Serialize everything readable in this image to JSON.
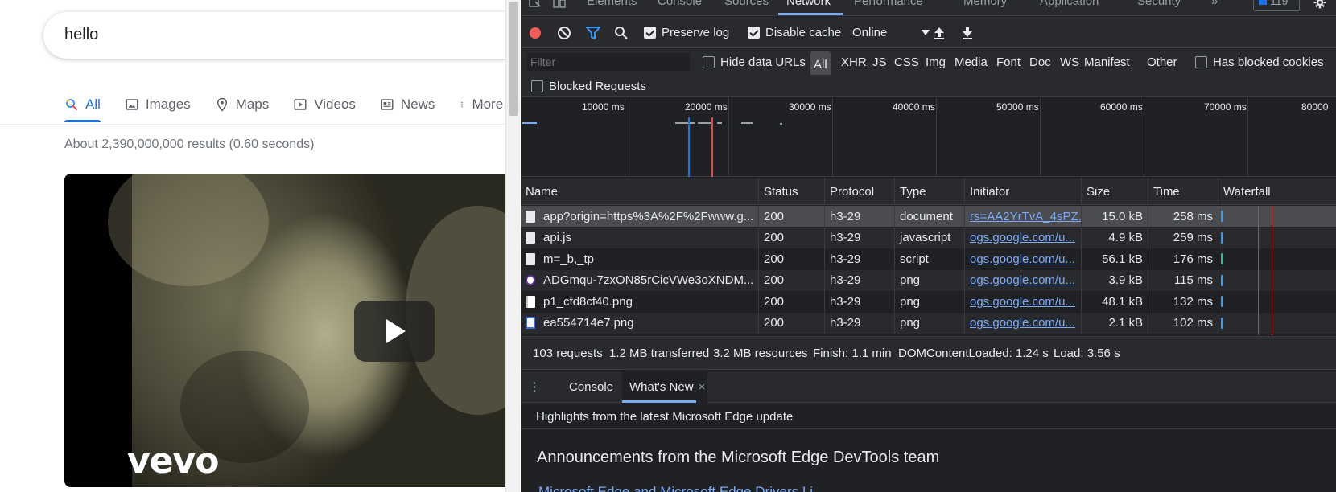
{
  "search": {
    "query": "hello",
    "tabs": [
      {
        "label": "All",
        "icon": "search-icon"
      },
      {
        "label": "Images",
        "icon": "image-icon"
      },
      {
        "label": "Maps",
        "icon": "map-pin-icon"
      },
      {
        "label": "Videos",
        "icon": "play-icon"
      },
      {
        "label": "News",
        "icon": "news-icon"
      },
      {
        "label": "More",
        "icon": "more-vert-icon"
      }
    ],
    "results_stats": "About 2,390,000,000 results (0.60 seconds)",
    "video_brand": "vevo"
  },
  "devtools": {
    "tabs": [
      "Elements",
      "Console",
      "Sources",
      "Network",
      "Performance",
      "Memory",
      "Application",
      "Security"
    ],
    "active_tab": "Network",
    "more_tabs": "»",
    "issues_count": "119",
    "toolbar": {
      "preserve_log": "Preserve log",
      "preserve_log_checked": true,
      "disable_cache": "Disable cache",
      "disable_cache_checked": true,
      "throttling": "Online"
    },
    "filter": {
      "placeholder": "Filter",
      "hide_data_urls": "Hide data URLs",
      "types": [
        "All",
        "XHR",
        "JS",
        "CSS",
        "Img",
        "Media",
        "Font",
        "Doc",
        "WS",
        "Manifest",
        "Other"
      ],
      "active_type": "All",
      "has_blocked_cookies": "Has blocked cookies",
      "blocked_requests": "Blocked Requests"
    },
    "overview": {
      "labels": [
        "10000 ms",
        "20000 ms",
        "30000 ms",
        "40000 ms",
        "50000 ms",
        "60000 ms",
        "70000 ms",
        "80000"
      ]
    },
    "columns": [
      "Name",
      "Status",
      "Protocol",
      "Type",
      "Initiator",
      "Size",
      "Time",
      "Waterfall"
    ],
    "rows": [
      {
        "name": "app?origin=https%3A%2F%2Fwww.g...",
        "status": "200",
        "protocol": "h3-29",
        "type": "document",
        "initiator": "rs=AA2YrTvA_4sPZ...",
        "size": "15.0 kB",
        "time": "258 ms",
        "icon": "doc"
      },
      {
        "name": "api.js",
        "status": "200",
        "protocol": "h3-29",
        "type": "javascript",
        "initiator": "ogs.google.com/u...",
        "size": "4.9 kB",
        "time": "259 ms",
        "icon": "doc"
      },
      {
        "name": "m=_b,_tp",
        "status": "200",
        "protocol": "h3-29",
        "type": "script",
        "initiator": "ogs.google.com/u...",
        "size": "56.1 kB",
        "time": "176 ms",
        "icon": "doc"
      },
      {
        "name": "ADGmqu-7zxON85rCicVWe3oXNDM...",
        "status": "200",
        "protocol": "h3-29",
        "type": "png",
        "initiator": "ogs.google.com/u...",
        "size": "3.9 kB",
        "time": "115 ms",
        "icon": "png"
      },
      {
        "name": "p1_cfd8cf40.png",
        "status": "200",
        "protocol": "h3-29",
        "type": "png",
        "initiator": "ogs.google.com/u...",
        "size": "48.1 kB",
        "time": "132 ms",
        "icon": "img2"
      },
      {
        "name": "ea554714e7.png",
        "status": "200",
        "protocol": "h3-29",
        "type": "png",
        "initiator": "ogs.google.com/u...",
        "size": "2.1 kB",
        "time": "102 ms",
        "icon": "img3"
      }
    ],
    "summary": {
      "requests": "103 requests",
      "transferred": "1.2 MB transferred",
      "resources": "3.2 MB resources",
      "finish": "Finish: 1.1 min",
      "dcl": "DOMContentLoaded: 1.24 s",
      "load": "Load: 3.56 s"
    },
    "drawer": {
      "menu": "⋮",
      "tabs": [
        "Console",
        "What's New"
      ],
      "active": "What's New",
      "close": "×",
      "highlights": "Highlights from the latest Microsoft Edge update",
      "announcement": "Announcements from the Microsoft Edge DevTools team",
      "link": "Microsoft Edge and Microsoft Edge Drivers Li..."
    },
    "colors": {
      "accent": "#7cacf8",
      "record": "#f25c54",
      "filter_icon": "#3c9af0",
      "dcl_line": "#1a73e8",
      "load_line": "#e34c4c"
    }
  }
}
